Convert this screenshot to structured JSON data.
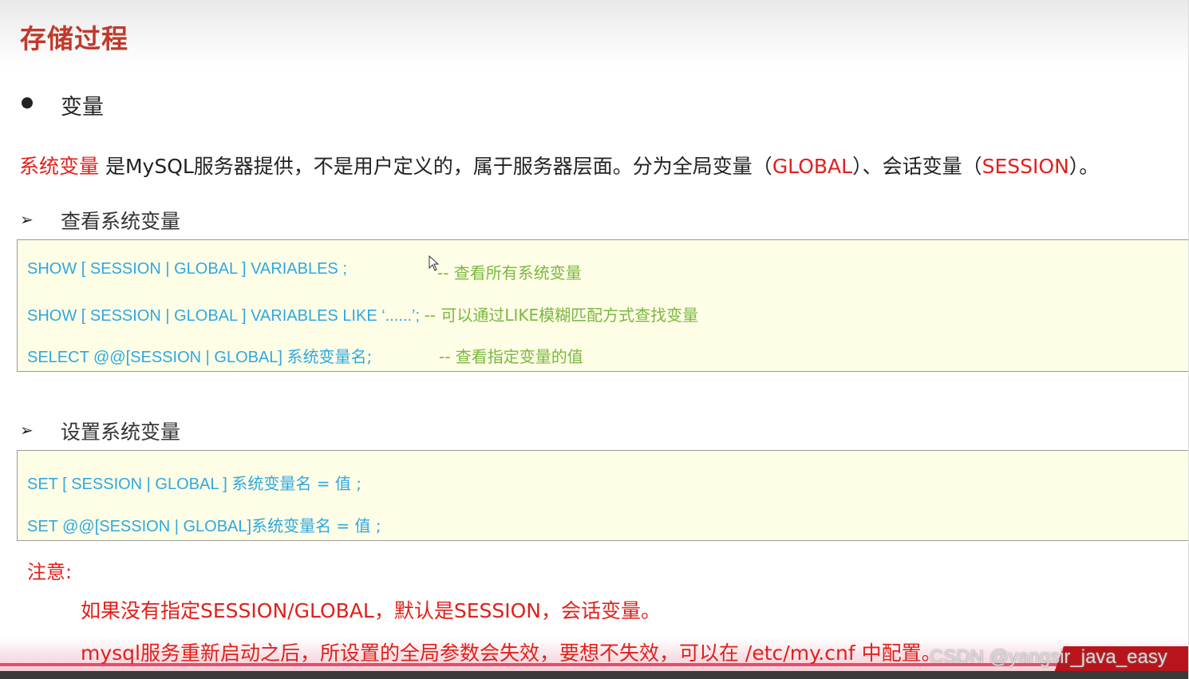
{
  "title": "存储过程",
  "section": {
    "label": "变量"
  },
  "intro": {
    "term": "系统变量",
    "text1": " 是MySQL服务器提供，不是用户定义的，属于服务器层面。分为全局变量（",
    "global": "GLOBAL",
    "text2": "）、会话变量（",
    "session": "SESSION",
    "text3": "）。"
  },
  "view": {
    "heading": "查看系统变量",
    "lines": [
      {
        "code": "SHOW  [ SESSION | GLOBAL ]   VARIABLES ;",
        "comment": "-- 查看所有系统变量"
      },
      {
        "code": "SHOW  [ SESSION | GLOBAL ]   VARIABLES  LIKE  ‘......’;",
        "comment": "-- 可以通过LIKE模糊匹配方式查找变量"
      },
      {
        "code": "SELECT  @@[SESSION | GLOBAL]  ",
        "code_cn": "系统变量名;",
        "comment": "--  查看指定变量的值"
      }
    ]
  },
  "set": {
    "heading": "设置系统变量",
    "lines": [
      {
        "code": "SET  [ SESSION | GLOBAL ]   ",
        "code_cn": "系统变量名 = 值 ;"
      },
      {
        "code": "SET  @@[SESSION | GLOBAL]",
        "code_cn": "系统变量名 = 值 ;"
      }
    ]
  },
  "note": {
    "heading": "注意:",
    "items": [
      "如果没有指定SESSION/GLOBAL，默认是SESSION，会话变量。",
      "mysql服务重新启动之后，所设置的全局参数会失效，要想不失效，可以在 /etc/my.cnf 中配置。"
    ]
  },
  "watermark": "CSDN @yangsir_java_easy",
  "colors": {
    "title_red": "#c0392b",
    "accent_red": "#e0201b",
    "code_blue": "#2ea8e0",
    "comment_green": "#7ab83f",
    "code_bg": "#fefde6"
  },
  "icons": [
    "bullet-icon",
    "arrow-icon",
    "mouse-cursor-icon"
  ]
}
